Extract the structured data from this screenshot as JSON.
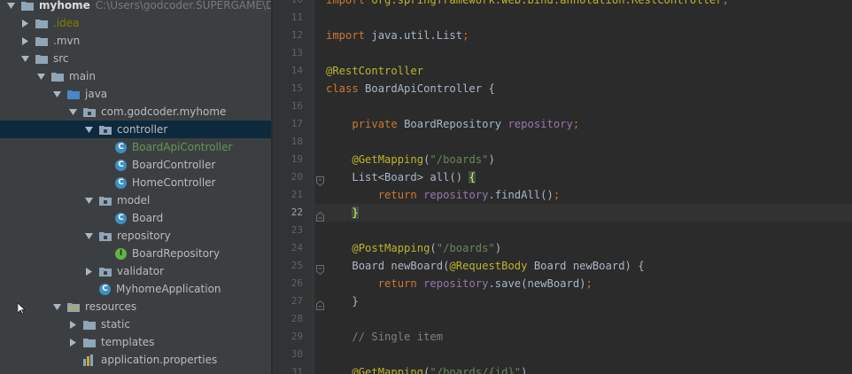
{
  "project_tree": {
    "root": {
      "label": "myhome",
      "path": "C:\\Users\\godcoder.SUPERGAME\\De"
    },
    "items": [
      {
        "label": ".idea",
        "kind": "folder",
        "depth": 1,
        "arrow": "right",
        "style": "ignored"
      },
      {
        "label": ".mvn",
        "kind": "folder",
        "depth": 1,
        "arrow": "right",
        "style": "normal"
      },
      {
        "label": "src",
        "kind": "folder",
        "depth": 1,
        "arrow": "down",
        "style": "normal"
      },
      {
        "label": "main",
        "kind": "folder",
        "depth": 2,
        "arrow": "down",
        "style": "normal"
      },
      {
        "label": "java",
        "kind": "folder-source",
        "depth": 3,
        "arrow": "down",
        "style": "normal"
      },
      {
        "label": "com.godcoder.myhome",
        "kind": "package",
        "depth": 4,
        "arrow": "down",
        "style": "normal"
      },
      {
        "label": "controller",
        "kind": "package",
        "depth": 5,
        "arrow": "down",
        "style": "normal",
        "selected": true
      },
      {
        "label": "BoardApiController",
        "kind": "class",
        "depth": 6,
        "arrow": "none",
        "style": "active"
      },
      {
        "label": "BoardController",
        "kind": "class",
        "depth": 6,
        "arrow": "none",
        "style": "normal"
      },
      {
        "label": "HomeController",
        "kind": "class",
        "depth": 6,
        "arrow": "none",
        "style": "normal"
      },
      {
        "label": "model",
        "kind": "package",
        "depth": 5,
        "arrow": "down",
        "style": "normal"
      },
      {
        "label": "Board",
        "kind": "class",
        "depth": 6,
        "arrow": "none",
        "style": "normal"
      },
      {
        "label": "repository",
        "kind": "package",
        "depth": 5,
        "arrow": "down",
        "style": "normal"
      },
      {
        "label": "BoardRepository",
        "kind": "interface",
        "depth": 6,
        "arrow": "none",
        "style": "normal"
      },
      {
        "label": "validator",
        "kind": "package",
        "depth": 5,
        "arrow": "right",
        "style": "normal"
      },
      {
        "label": "MyhomeApplication",
        "kind": "class-app",
        "depth": 5,
        "arrow": "none",
        "style": "normal"
      },
      {
        "label": "resources",
        "kind": "folder-resources",
        "depth": 3,
        "arrow": "down",
        "style": "normal"
      },
      {
        "label": "static",
        "kind": "folder",
        "depth": 4,
        "arrow": "right",
        "style": "normal"
      },
      {
        "label": "templates",
        "kind": "folder",
        "depth": 4,
        "arrow": "right",
        "style": "normal"
      },
      {
        "label": "application.properties",
        "kind": "properties",
        "depth": 4,
        "arrow": "none",
        "style": "normal"
      }
    ]
  },
  "editor": {
    "current_line": "22",
    "lines": [
      {
        "num": "10",
        "tokens": [
          {
            "t": "import ",
            "c": "kw"
          },
          {
            "t": "org.springframework.web.bind.annotation.RestController",
            "c": "ann"
          },
          {
            "t": ";",
            "c": "kw"
          }
        ]
      },
      {
        "num": "11",
        "tokens": []
      },
      {
        "num": "12",
        "tokens": [
          {
            "t": "import ",
            "c": "kw"
          },
          {
            "t": "java.util.List",
            "c": ""
          },
          {
            "t": ";",
            "c": "kw"
          }
        ]
      },
      {
        "num": "13",
        "tokens": []
      },
      {
        "num": "14",
        "tokens": [
          {
            "t": "@RestController",
            "c": "ann"
          }
        ]
      },
      {
        "num": "15",
        "tokens": [
          {
            "t": "class ",
            "c": "kw"
          },
          {
            "t": "BoardApiController {",
            "c": ""
          }
        ]
      },
      {
        "num": "16",
        "tokens": []
      },
      {
        "num": "17",
        "tokens": [
          {
            "t": "    ",
            "c": ""
          },
          {
            "t": "private ",
            "c": "kw"
          },
          {
            "t": "BoardRepository ",
            "c": ""
          },
          {
            "t": "repository",
            "c": "fld"
          },
          {
            "t": ";",
            "c": "kw"
          }
        ]
      },
      {
        "num": "18",
        "tokens": []
      },
      {
        "num": "19",
        "tokens": [
          {
            "t": "    ",
            "c": ""
          },
          {
            "t": "@GetMapping",
            "c": "ann"
          },
          {
            "t": "(",
            "c": ""
          },
          {
            "t": "\"/boards\"",
            "c": "str"
          },
          {
            "t": ")",
            "c": ""
          }
        ]
      },
      {
        "num": "20",
        "tokens": [
          {
            "t": "    ",
            "c": ""
          },
          {
            "t": "List<Board> all() ",
            "c": ""
          },
          {
            "t": "{",
            "c": "brace-hl"
          }
        ]
      },
      {
        "num": "21",
        "tokens": [
          {
            "t": "        ",
            "c": ""
          },
          {
            "t": "return ",
            "c": "kw"
          },
          {
            "t": "repository",
            "c": "fld"
          },
          {
            "t": ".findAll()",
            "c": ""
          },
          {
            "t": ";",
            "c": "kw"
          }
        ]
      },
      {
        "num": "22",
        "tokens": [
          {
            "t": "    ",
            "c": ""
          },
          {
            "t": "}",
            "c": "brace-hl"
          }
        ]
      },
      {
        "num": "23",
        "tokens": []
      },
      {
        "num": "24",
        "tokens": [
          {
            "t": "    ",
            "c": ""
          },
          {
            "t": "@PostMapping",
            "c": "ann"
          },
          {
            "t": "(",
            "c": ""
          },
          {
            "t": "\"/boards\"",
            "c": "str"
          },
          {
            "t": ")",
            "c": ""
          }
        ]
      },
      {
        "num": "25",
        "tokens": [
          {
            "t": "    ",
            "c": ""
          },
          {
            "t": "Board newBoard(",
            "c": ""
          },
          {
            "t": "@RequestBody ",
            "c": "ann"
          },
          {
            "t": "Board newBoard) {",
            "c": ""
          }
        ]
      },
      {
        "num": "26",
        "tokens": [
          {
            "t": "        ",
            "c": ""
          },
          {
            "t": "return ",
            "c": "kw"
          },
          {
            "t": "repository",
            "c": "fld"
          },
          {
            "t": ".save(newBoard)",
            "c": ""
          },
          {
            "t": ";",
            "c": "kw"
          }
        ]
      },
      {
        "num": "27",
        "tokens": [
          {
            "t": "    }",
            "c": ""
          }
        ]
      },
      {
        "num": "28",
        "tokens": []
      },
      {
        "num": "29",
        "tokens": [
          {
            "t": "    ",
            "c": ""
          },
          {
            "t": "// Single item",
            "c": "cmt"
          }
        ]
      },
      {
        "num": "30",
        "tokens": []
      },
      {
        "num": "31",
        "tokens": [
          {
            "t": "    ",
            "c": ""
          },
          {
            "t": "@GetMapping",
            "c": "ann"
          },
          {
            "t": "(",
            "c": ""
          },
          {
            "t": "\"/boards/{id}\"",
            "c": "str"
          },
          {
            "t": ")",
            "c": ""
          }
        ]
      }
    ]
  },
  "colors": {
    "panel_bg": "#3c3f41",
    "editor_bg": "#2b2b2b",
    "gutter_bg": "#313335",
    "selection": "#0d293e",
    "keyword": "#cc7832",
    "annotation": "#bbb529",
    "string": "#6a8759",
    "field": "#9876aa",
    "comment": "#808080"
  },
  "icons": [
    "arrow-right-icon",
    "arrow-down-icon",
    "folder-icon",
    "package-icon",
    "class-icon",
    "interface-icon",
    "properties-file-icon",
    "mouse-cursor-icon"
  ]
}
